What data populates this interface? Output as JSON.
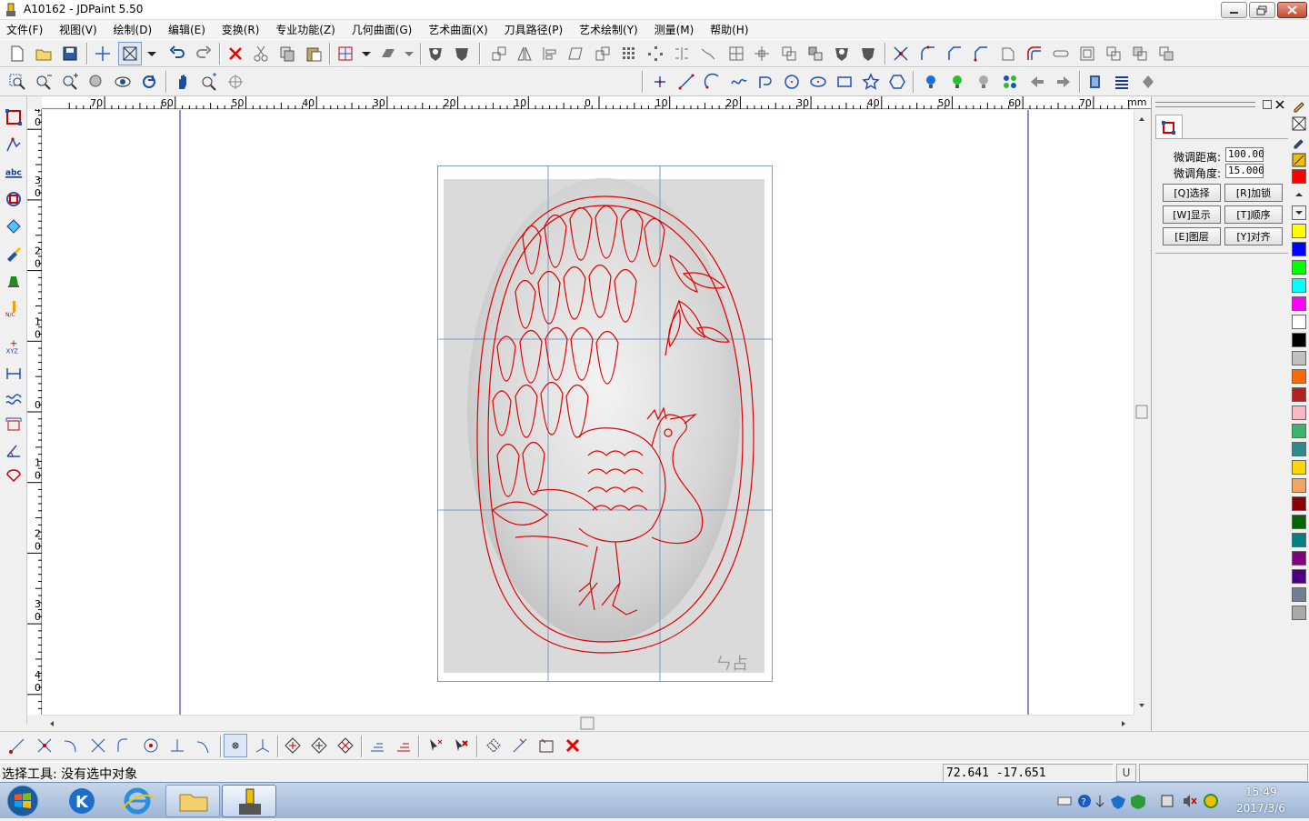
{
  "window": {
    "title": "A10162 - JDPaint 5.50"
  },
  "menu": [
    {
      "label": "文件(F)"
    },
    {
      "label": "视图(V)"
    },
    {
      "label": "绘制(D)"
    },
    {
      "label": "编辑(E)"
    },
    {
      "label": "变换(R)"
    },
    {
      "label": "专业功能(Z)"
    },
    {
      "label": "几何曲面(G)"
    },
    {
      "label": "艺术曲面(X)"
    },
    {
      "label": "刀具路径(P)"
    },
    {
      "label": "艺术绘制(Y)"
    },
    {
      "label": "测量(M)"
    },
    {
      "label": "帮助(H)"
    }
  ],
  "ruler": {
    "h_labels": [
      "70",
      "60",
      "50",
      "40",
      "30",
      "20",
      "10",
      "0",
      "10",
      "20",
      "30",
      "40",
      "50",
      "60",
      "70"
    ],
    "unit": "mm",
    "v_labels": [
      "4\n0",
      "3\n0",
      "2\n0",
      "1\n0",
      "0",
      "1\n0",
      "2\n0",
      "3\n0",
      "4\n0"
    ]
  },
  "panel": {
    "nudge_distance_label": "微调距离:",
    "nudge_distance_value": "100.00",
    "nudge_angle_label": "微调角度:",
    "nudge_angle_value": "15.000",
    "buttons": [
      {
        "label": "[Q]选择"
      },
      {
        "label": "[R]加锁"
      },
      {
        "label": "[W]显示"
      },
      {
        "label": "[T]顺序"
      },
      {
        "label": "[E]图层"
      },
      {
        "label": "[Y]对齐"
      }
    ]
  },
  "palette": {
    "colors": [
      "#ff0000",
      "#ffff00",
      "#0000ff",
      "#00ff00",
      "#00ffff",
      "#ff00ff",
      "#ffffff",
      "#000000",
      "#c0c0c0",
      "#ff6a00",
      "#b22222",
      "#ffb6c1",
      "#3cb371",
      "#2e8b8b",
      "#ffd700",
      "#f4a460",
      "#8b0000",
      "#006400",
      "#008080",
      "#800080",
      "#4b0082",
      "#708090",
      "#a9a9a9"
    ]
  },
  "artwork": {
    "signature": "ㄣ占"
  },
  "status": {
    "message": "选择工具: 没有选中对象",
    "coords": "72.641  -17.651",
    "mode": "U"
  },
  "taskbar": {
    "time": "15:49",
    "date": "2017/3/6"
  },
  "icons": [
    "new-icon",
    "open-icon",
    "save-icon",
    "select-icon",
    "undo-icon",
    "redo-icon",
    "delete-icon",
    "cut-icon",
    "copy-icon",
    "paste-icon",
    "zoom-icon",
    "pan-icon",
    "point-icon",
    "line-icon",
    "arc-icon",
    "spline-icon",
    "circle-icon",
    "ellipse-icon",
    "rect-icon",
    "star-icon",
    "polygon-icon"
  ]
}
